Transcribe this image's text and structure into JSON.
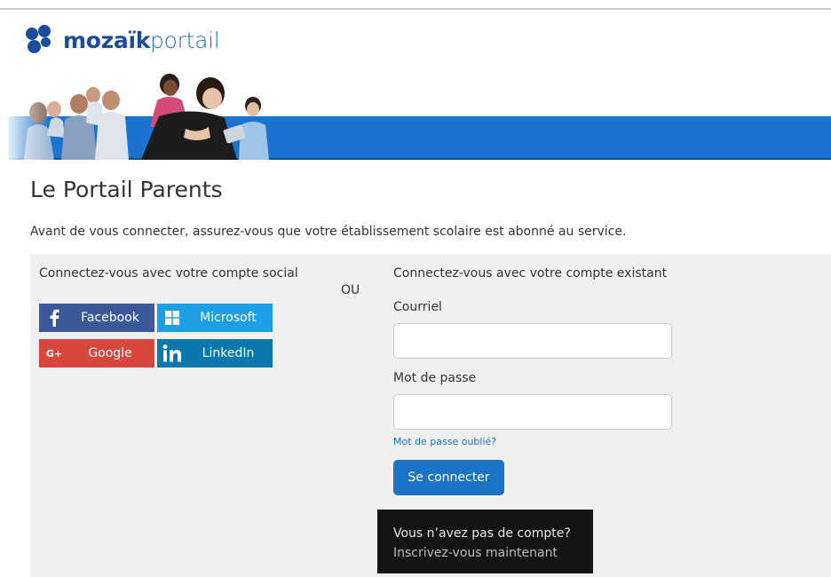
{
  "brand": {
    "name_bold": "mozaïk",
    "name_light": "portail",
    "primary_color": "#1b4d9c",
    "banner_color": "#1a74cf"
  },
  "header": {
    "title": "Le Portail Parents",
    "subtitle": "Avant de vous connecter, assurez-vous que votre établissement scolaire est abonné au service."
  },
  "social": {
    "heading": "Connectez-vous avec votre compte social",
    "or_label": "OU",
    "buttons": [
      {
        "label": "Facebook",
        "icon": "facebook-icon",
        "color": "#3b5998"
      },
      {
        "label": "Microsoft",
        "icon": "microsoft-icon",
        "color": "#1e9ee4"
      },
      {
        "label": "Google",
        "icon": "google-plus-icon",
        "color": "#d9463e"
      },
      {
        "label": "LinkedIn",
        "icon": "linkedin-icon",
        "color": "#0b78ad"
      }
    ]
  },
  "login": {
    "heading": "Connectez-vous avec votre compte existant",
    "email_label": "Courriel",
    "email_value": "",
    "password_label": "Mot de passe",
    "password_value": "",
    "forgot_label": "Mot de passe oublié?",
    "submit_label": "Se connecter",
    "submit_color": "#1a73c8"
  },
  "signup": {
    "question": "Vous n’avez pas de compte?",
    "link_label": "Inscrivez-vous maintenant"
  }
}
